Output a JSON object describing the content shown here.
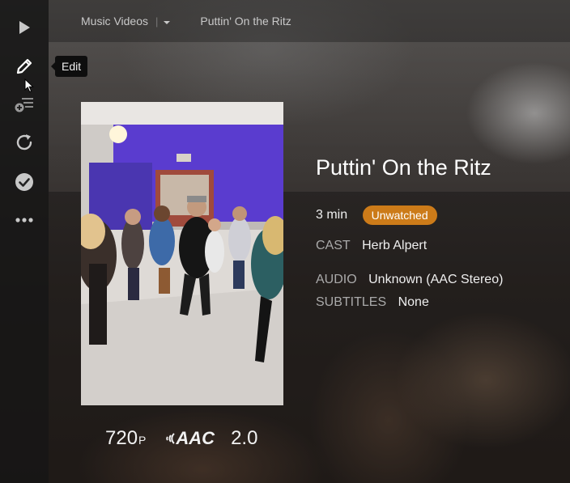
{
  "breadcrumb": {
    "section": "Music Videos",
    "separator": "|",
    "current": "Puttin' On the Ritz"
  },
  "tooltip": {
    "text": "Edit"
  },
  "rail": {
    "icons": [
      "play-icon",
      "edit-icon",
      "add-to-playlist-icon",
      "refresh-icon",
      "mark-watched-icon",
      "more-icon"
    ]
  },
  "video": {
    "title": "Puttin' On the Ritz",
    "duration": "3 min",
    "status": "Unwatched",
    "cast_label": "CAST",
    "cast": "Herb Alpert",
    "audio_label": "AUDIO",
    "audio": "Unknown (AAC Stereo)",
    "subtitles_label": "SUBTITLES",
    "subtitles": "None"
  },
  "codecs": {
    "resolution": "720",
    "resolution_suffix": "P",
    "audio_codec": "AAC",
    "channels": "2.0"
  },
  "colors": {
    "accent": "#cc7b19",
    "rail_bg": "#141414",
    "poster_wall": "#5a3ccf"
  }
}
